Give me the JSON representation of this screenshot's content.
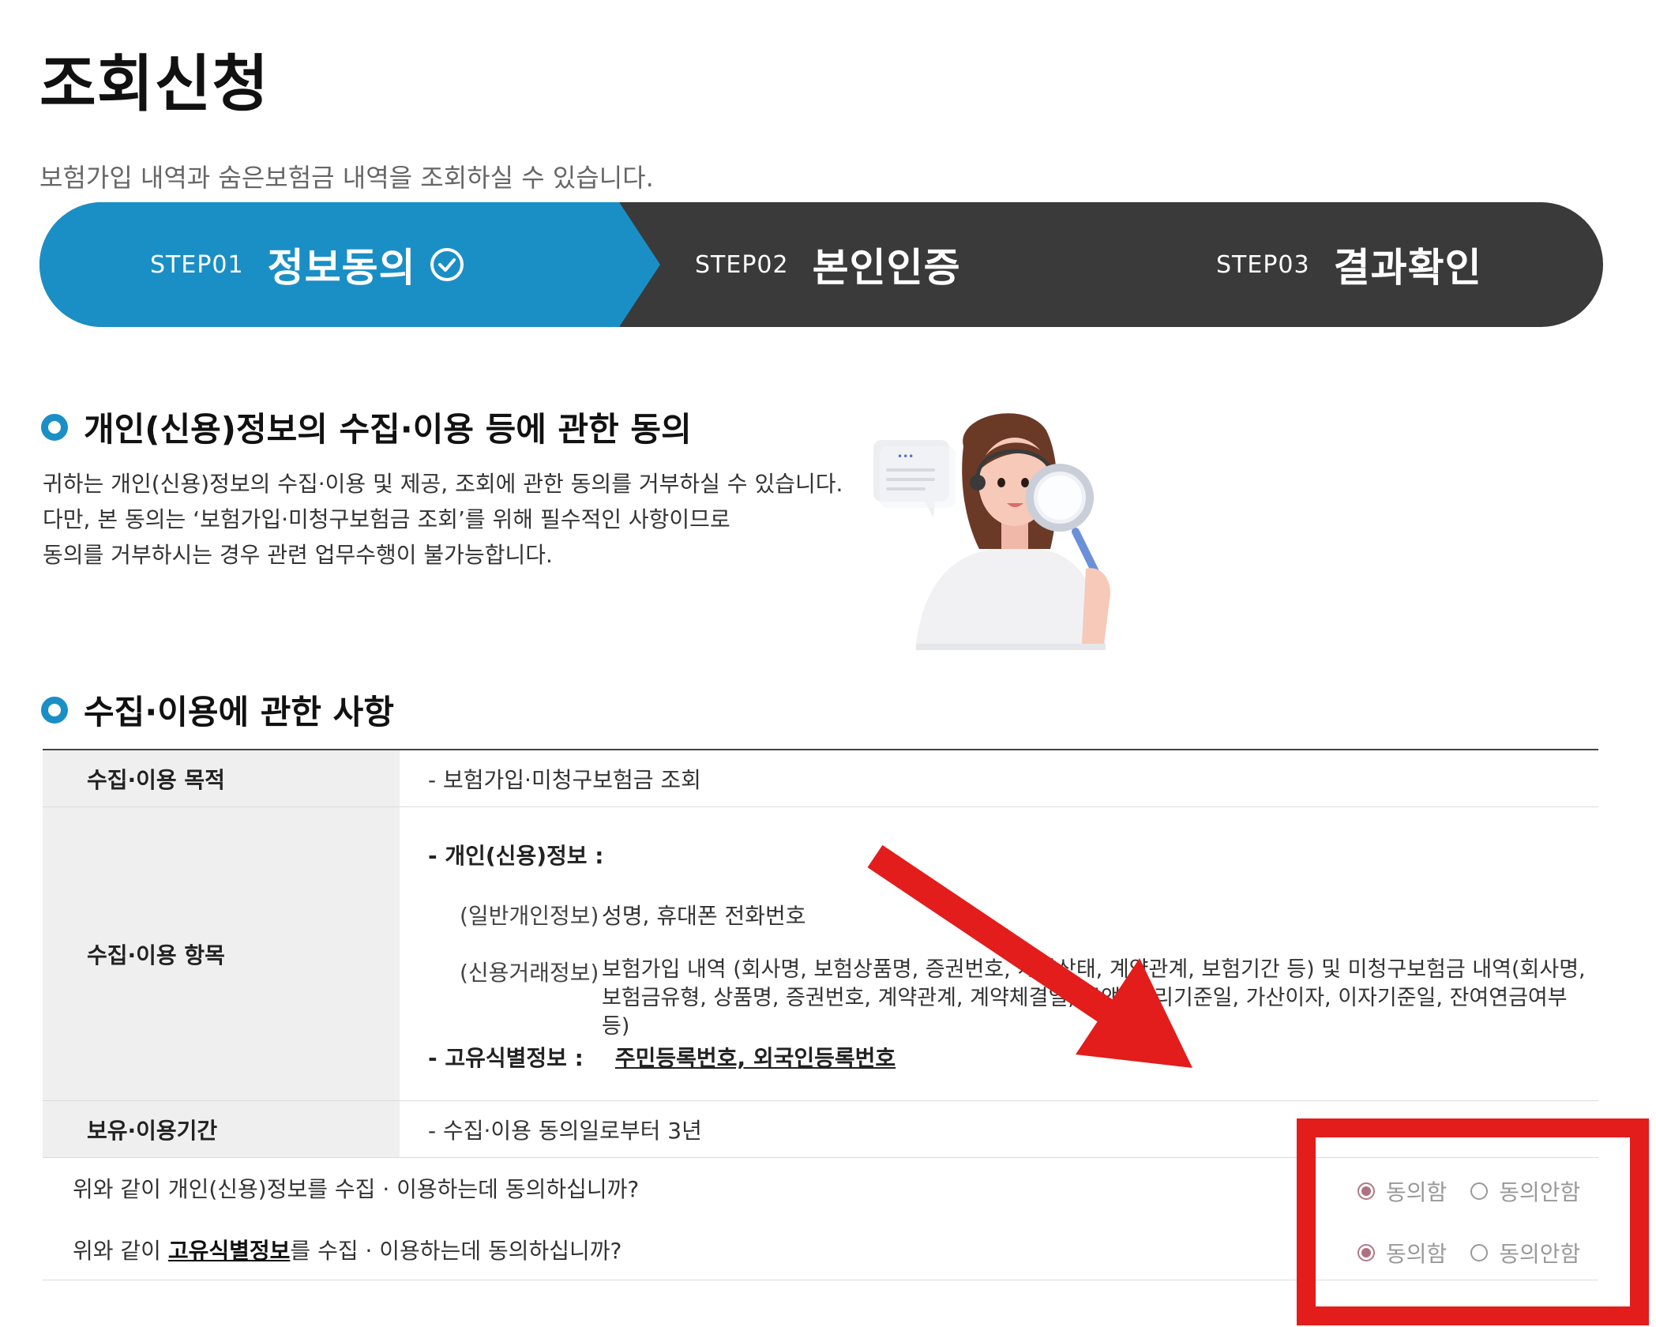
{
  "page": {
    "title": "조회신청",
    "subtitle": "보험가입 내역과 숨은보험금 내역을 조회하실 수 있습니다."
  },
  "stepper": {
    "steps": [
      {
        "num": "STEP01",
        "name": "정보동의",
        "active": true
      },
      {
        "num": "STEP02",
        "name": "본인인증",
        "active": false
      },
      {
        "num": "STEP03",
        "name": "결과확인",
        "active": false
      }
    ],
    "active_color": "#1a8fc6",
    "inactive_color": "#3a3a3a"
  },
  "consent_section": {
    "title": "개인(신용)정보의 수집·이용 등에 관한 동의",
    "lines": [
      "귀하는 개인(신용)정보의 수집·이용 및 제공, 조회에 관한 동의를 거부하실 수 있습니다.",
      "다만, 본 동의는 ‘보험가입·미청구보험금 조회’를 위해 필수적인 사항이므로",
      "동의를 거부하시는 경우 관련 업무수행이 불가능합니다."
    ]
  },
  "usage_section": {
    "title": "수집·이용에 관한 사항",
    "rows": {
      "purpose": {
        "label": "수집·이용 목적",
        "value": "- 보험가입·미청구보험금 조회"
      },
      "items": {
        "label": "수집·이용 항목",
        "personal_heading": "- 개인(신용)정보 :",
        "general_label": "(일반개인정보)",
        "general_value": "성명, 휴대폰 전화번호",
        "credit_label": "(신용거래정보)",
        "credit_value_1": "보험가입 내역 (회사명, 보험상품명, 증권번호, 계약상태, 계약관계, 보험기간 등) 및 미청구보험금 내역(회사명,",
        "credit_value_2": "보험금유형, 상품명, 증권번호, 계약관계, 계약체결일, 금액, 금리기준일, 가산이자, 이자기준일, 잔여연금여부 등)",
        "unique_heading": "- 고유식별정보 :",
        "unique_value": "주민등록번호, 외국인등록번호"
      },
      "retention": {
        "label": "보유·이용기간",
        "value": "- 수집·이용 동의일로부터 3년"
      }
    }
  },
  "questions": [
    {
      "pre": "위와 같이 개인(신용)정보를 수집 · 이용하는데 동의하십니까?",
      "emph": "",
      "post": "",
      "agree": "동의함",
      "disagree": "동의안함",
      "selected": "agree"
    },
    {
      "pre": "위와 같이 ",
      "emph": "고유식별정보",
      "post": "를 수집 · 이용하는데 동의하십니까?",
      "agree": "동의함",
      "disagree": "동의안함",
      "selected": "agree"
    }
  ],
  "chat_bubble_dots": "•••",
  "annotation_color": "#e31c1c"
}
